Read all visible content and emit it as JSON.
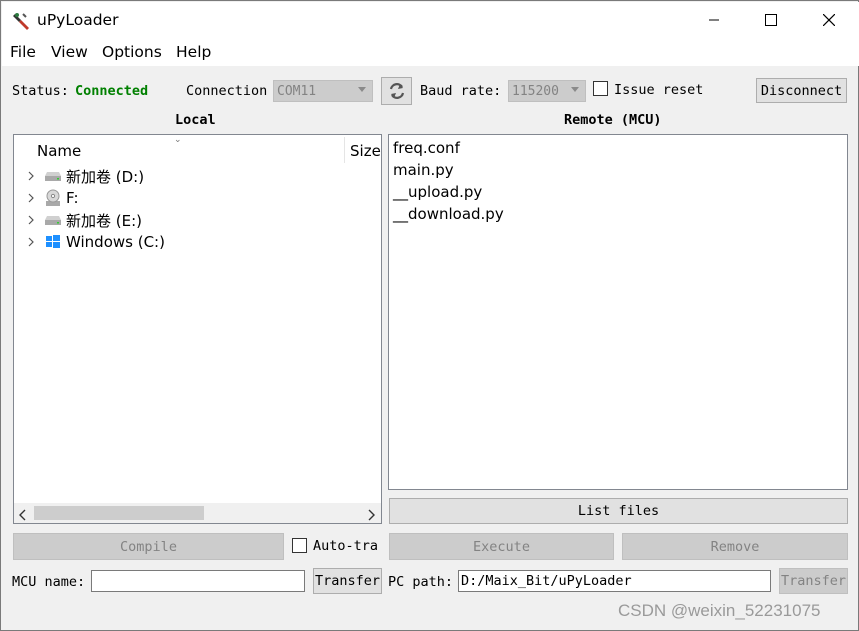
{
  "window": {
    "title": "uPyLoader",
    "controls": {
      "minimize": "—",
      "maximize": "☐",
      "close": "✕"
    }
  },
  "menu": [
    "File",
    "View",
    "Options",
    "Help"
  ],
  "status": {
    "label": "Status:",
    "value": "Connected",
    "value_color": "#008000"
  },
  "connection": {
    "label": "Connection",
    "port": "COM11",
    "baud_label": "Baud rate:",
    "baud": "115200",
    "issue_reset_label": "Issue reset",
    "issue_reset_checked": false,
    "disconnect_label": "Disconnect"
  },
  "local": {
    "header": "Local",
    "columns": {
      "name": "Name",
      "size": "Size"
    },
    "items": [
      {
        "label": "新加卷 (D:)",
        "icon": "drive-icon"
      },
      {
        "label": "F:",
        "icon": "cd-drive-icon"
      },
      {
        "label": "新加卷 (E:)",
        "icon": "drive-icon"
      },
      {
        "label": "Windows (C:)",
        "icon": "windows-drive-icon"
      }
    ]
  },
  "remote": {
    "header": "Remote (MCU)",
    "files": [
      "freq.conf",
      "main.py",
      "__upload.py",
      "__download.py"
    ],
    "list_files_label": "List files"
  },
  "actions": {
    "compile": "Compile",
    "auto_transfer": "Auto-tra",
    "execute": "Execute",
    "remove": "Remove"
  },
  "bottom": {
    "mcu_name_label": "MCU name:",
    "mcu_name_value": "",
    "transfer_label": "Transfer",
    "pc_path_label": "PC path:",
    "pc_path_value": "D:/Maix_Bit/uPyLoader",
    "transfer2_label": "Transfer"
  },
  "watermark": "CSDN @weixin_52231075"
}
